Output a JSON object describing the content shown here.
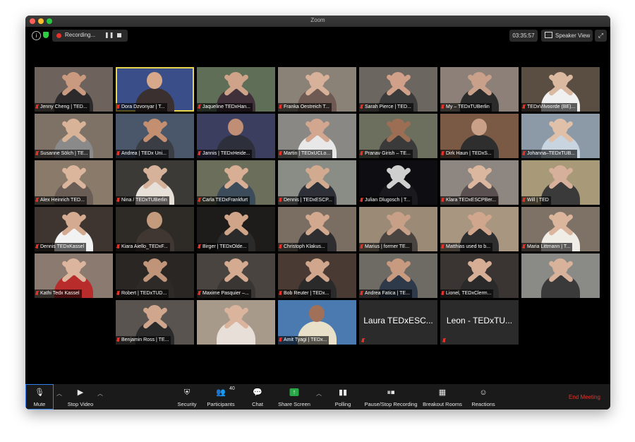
{
  "window": {
    "title": "Zoom"
  },
  "topbar": {
    "info_label": "i",
    "recording_label": "Recording...",
    "pause_glyph": "❚❚",
    "timer": "03:35:57",
    "view_label": "Speaker View",
    "fullscreen_glyph": "⤢"
  },
  "tiles": [
    {
      "label": "Jenny Cheng | TED...",
      "bg": "#6d625c",
      "skin": "#c99a7f",
      "shirt": "#2d2a2b",
      "arms": true
    },
    {
      "label": "Dora Dzvonyar | T...",
      "bg": "#3a4f8a",
      "skin": "#d7a98a",
      "shirt": "#3a3030",
      "arms": false,
      "active": true
    },
    {
      "label": "Jaqueline TEDxHan...",
      "bg": "#5e6e57",
      "skin": "#cfa38a",
      "shirt": "#40303a",
      "arms": true
    },
    {
      "label": "Franka Oestreich T...",
      "bg": "#8a8276",
      "skin": "#d8b19a",
      "shirt": "#6e5a52",
      "arms": true
    },
    {
      "label": "Sarah Pierce | TED...",
      "bg": "#6b6660",
      "skin": "#d0a088",
      "shirt": "#3b3b3b",
      "arms": true
    },
    {
      "label": "My – TEDxTUBerlin",
      "bg": "#8c8078",
      "skin": "#c9a08a",
      "shirt": "#2b2b2b",
      "arms": true
    },
    {
      "label": "TEDxVilvoorde (BE)...",
      "bg": "#5a4e42",
      "skin": "#dbb8a0",
      "shirt": "#f0f0f0",
      "arms": true
    },
    {
      "label": "Susanne Sölch | TE...",
      "bg": "#7e7165",
      "skin": "#d9b397",
      "shirt": "#8a8a8a",
      "arms": true
    },
    {
      "label": "Andrea | TEDx Uni...",
      "bg": "#4a566a",
      "skin": "#c48f70",
      "shirt": "#3a3d44",
      "arms": true
    },
    {
      "label": "Jannis | TEDxHeide...",
      "bg": "#3b3e5e",
      "skin": "#c08e74",
      "shirt": "#2d2f3a",
      "arms": false
    },
    {
      "label": "Martin | TEDxUCLo...",
      "bg": "#8a8884",
      "skin": "#d2a68f",
      "shirt": "#e8e8e8",
      "arms": true
    },
    {
      "label": "Pranav Girish – TE...",
      "bg": "#6c6e5e",
      "skin": "#9c6f55",
      "shirt": "#3a3a3a",
      "arms": true
    },
    {
      "label": "Dirk Haun | TEDxS...",
      "bg": "#7a5a45",
      "skin": "#caa088",
      "shirt": "#2e2e2e",
      "arms": false
    },
    {
      "label": "Johanna–TEDxTUB...",
      "bg": "#8c9aa8",
      "skin": "#e0c0a8",
      "shirt": "#c8d4e0",
      "arms": true
    },
    {
      "label": "Alex Heinrich TED...",
      "bg": "#8a7a6a",
      "skin": "#dcb59d",
      "shirt": "#6a5d55",
      "arms": true
    },
    {
      "label": "Nina / TEDxTUBerlin",
      "bg": "#3c3a36",
      "skin": "#d6b29b",
      "shirt": "#e6e0d8",
      "arms": true
    },
    {
      "label": "Carla TEDxFrankfurt",
      "bg": "#6a6e5a",
      "skin": "#d8ae95",
      "shirt": "#3c4c5a",
      "arms": true
    },
    {
      "label": "Dennis | TEDxESCP...",
      "bg": "#8a8c86",
      "skin": "#d2aa90",
      "shirt": "#2e3038",
      "arms": true
    },
    {
      "label": "Julian Dlugosch | T...",
      "bg": "#0e0e12",
      "skin": "#cfcfcf",
      "shirt": "#1a1a1e",
      "arms": true
    },
    {
      "label": "Klara TEDxESCPBer...",
      "bg": "#8e8680",
      "skin": "#dcb7a0",
      "shirt": "#5a5050",
      "arms": true
    },
    {
      "label": "Will | TED",
      "bg": "#a89a78",
      "skin": "#d6b09a",
      "shirt": "#3a3a3a",
      "arms": true
    },
    {
      "label": "Dennis TEDxKassel",
      "bg": "#3e3530",
      "skin": "#d4aa90",
      "shirt": "#f2f2f2",
      "arms": true
    },
    {
      "label": "Kiara Aiello_TEDxF...",
      "bg": "#2e2a26",
      "skin": "#c49a7c",
      "shirt": "#403632",
      "arms": false
    },
    {
      "label": "Birger | TEDxOlde...",
      "bg": "#1e1c1a",
      "skin": "#d0a488",
      "shirt": "#2a2a2a",
      "arms": true
    },
    {
      "label": "Christoph Klakus...",
      "bg": "#7a6e62",
      "skin": "#d2a88e",
      "shirt": "#2e2e30",
      "arms": true
    },
    {
      "label": "Marius | former TE...",
      "bg": "#9a8a76",
      "skin": "#c8a088",
      "shirt": "#4a4440",
      "arms": true
    },
    {
      "label": "Matthias used to b...",
      "bg": "#a89680",
      "skin": "#d0a68c",
      "shirt": "#2e2e2e",
      "arms": true
    },
    {
      "label": "Maria Littmann | T...",
      "bg": "#7e7266",
      "skin": "#dbb59c",
      "shirt": "#f0ece6",
      "arms": true
    },
    {
      "label": "Kathi Tedx Kassel",
      "bg": "#8a7a70",
      "skin": "#dcb59e",
      "shirt": "#b82c2c",
      "arms": true
    },
    {
      "label": "Robert | TEDxTUD...",
      "bg": "#2a2624",
      "skin": "#c09478",
      "shirt": "#2e2a28",
      "arms": true
    },
    {
      "label": "Maxime Pasquier –...",
      "bg": "#4a4440",
      "skin": "#d4aa90",
      "shirt": "#3a3634",
      "arms": true
    },
    {
      "label": "Bob Reuter | TEDx...",
      "bg": "#4a3a34",
      "skin": "#d0a68c",
      "shirt": "#2a2a2a",
      "arms": true
    },
    {
      "label": "Andrea Fatica | TE...",
      "bg": "#6e6a64",
      "skin": "#c89a80",
      "shirt": "#2e3a4a",
      "arms": true
    },
    {
      "label": "Lionel, TEDxClerm...",
      "bg": "#3a3432",
      "skin": "#d6ae96",
      "shirt": "#2a2a2a",
      "arms": true
    },
    {
      "label": "",
      "bg": "#8a8a86",
      "skin": "#d8b29a",
      "shirt": "#3a3a3a",
      "arms": true
    },
    {
      "label": "Benjamin Ross | TE...",
      "bg": "#5a5450",
      "skin": "#d0a68c",
      "shirt": "#2a2a2a",
      "arms": true
    },
    {
      "label": "",
      "bg": "#a89a8a",
      "skin": "#dab49c",
      "shirt": "#e8e0d8",
      "arms": true
    },
    {
      "label": "Amit Tyagi | TEDx...",
      "bg": "#4a7ab0",
      "skin": "#a07058",
      "shirt": "#e8e0c8",
      "arms": false
    },
    {
      "label": "",
      "name_only": "Laura TEDxESC...",
      "bg": "#2b2b2b"
    },
    {
      "label": "",
      "name_only": "Leon - TEDxTU...",
      "bg": "#2b2b2b"
    }
  ],
  "toolbar": {
    "mute": "Mute",
    "stop_video": "Stop Video",
    "security": "Security",
    "participants": "Participants",
    "participants_count": "40",
    "chat": "Chat",
    "share_screen": "Share Screen",
    "polling": "Polling",
    "pause_stop_recording": "Pause/Stop Recording",
    "breakout_rooms": "Breakout Rooms",
    "reactions": "Reactions",
    "end_meeting": "End Meeting"
  }
}
